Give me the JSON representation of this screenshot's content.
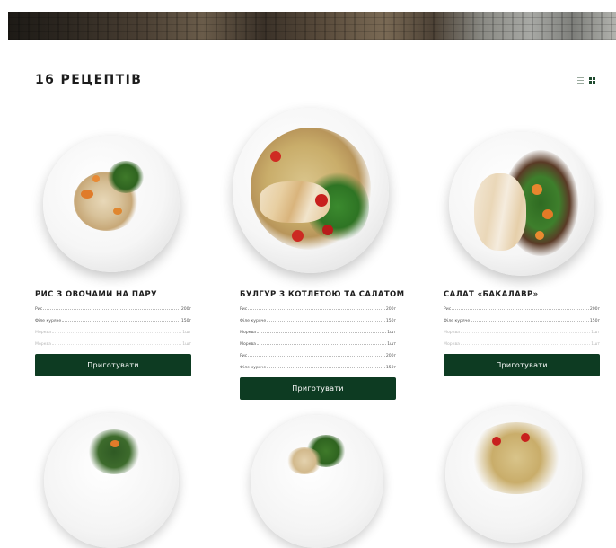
{
  "page": {
    "title": "16 РЕЦЕПТІВ"
  },
  "view_toggle": {
    "icons": [
      "list-view-icon",
      "grid-view-icon"
    ]
  },
  "cook_label": "Приготувати",
  "colors": {
    "accent": "#0d3b22",
    "inactive_icon": "#9aaa9e"
  },
  "cards": [
    {
      "title": "РИС З ОВОЧАМИ НА ПАРУ",
      "ingredients": [
        {
          "name": "Рис",
          "qty": "200г"
        },
        {
          "name": "Філе куряче",
          "qty": "150г"
        },
        {
          "name": "Морква",
          "qty": "1шт"
        },
        {
          "name": "Морква",
          "qty": "1шт"
        }
      ]
    },
    {
      "title": "БУЛГУР З КОТЛЕТОЮ ТА САЛАТОМ",
      "ingredients": [
        {
          "name": "Рис",
          "qty": "200г"
        },
        {
          "name": "Філе куряче",
          "qty": "150г"
        },
        {
          "name": "Морква",
          "qty": "1шт"
        },
        {
          "name": "Морква",
          "qty": "1шт"
        },
        {
          "name": "Рис",
          "qty": "200г"
        },
        {
          "name": "Філе куряче",
          "qty": "150г"
        }
      ]
    },
    {
      "title": "САЛАТ «БАКАЛАВР»",
      "ingredients": [
        {
          "name": "Рис",
          "qty": "200г"
        },
        {
          "name": "Філе куряче",
          "qty": "150г"
        },
        {
          "name": "Морква",
          "qty": "1шт"
        },
        {
          "name": "Морква",
          "qty": "1шт"
        }
      ]
    }
  ]
}
